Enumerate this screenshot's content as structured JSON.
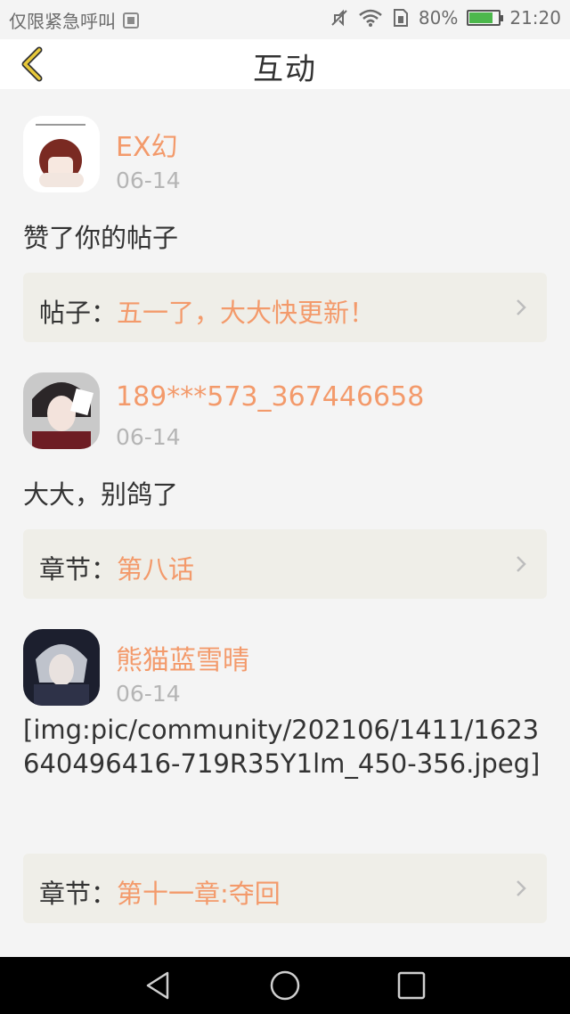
{
  "status_bar": {
    "carrier": "仅限紧急呼叫",
    "battery_pct": "80%",
    "time": "21:20",
    "battery_level": 0.8,
    "battery_color": "#4cb84c"
  },
  "header": {
    "title": "互动"
  },
  "items": [
    {
      "name": "EX幻",
      "date": "06-14",
      "content": "赞了你的帖子",
      "ref_label": "帖子：",
      "ref_text": "五一了，大大快更新！"
    },
    {
      "name": "189***573_367446658",
      "date": "06-14",
      "content": "大大，别鸽了",
      "ref_label": "章节：",
      "ref_text": "第八话"
    },
    {
      "name": "熊猫蓝雪晴",
      "date": "06-14",
      "content": "[img:pic/community/202106/1411/1623640496416-719R35Y1lm_450-356.jpeg]",
      "ref_label": "章节：",
      "ref_text": "第十一章:夺回"
    }
  ],
  "colors": {
    "accent": "#f39a6b",
    "muted": "#b5b5b5",
    "ref_bg": "#efeee8",
    "back_arrow": "#e8c93a"
  },
  "icons": {
    "back": "chevron-left-icon",
    "ref_arrow": "chevron-right-icon",
    "nav_back": "triangle-back-icon",
    "nav_home": "circle-home-icon",
    "nav_recents": "square-recents-icon"
  }
}
